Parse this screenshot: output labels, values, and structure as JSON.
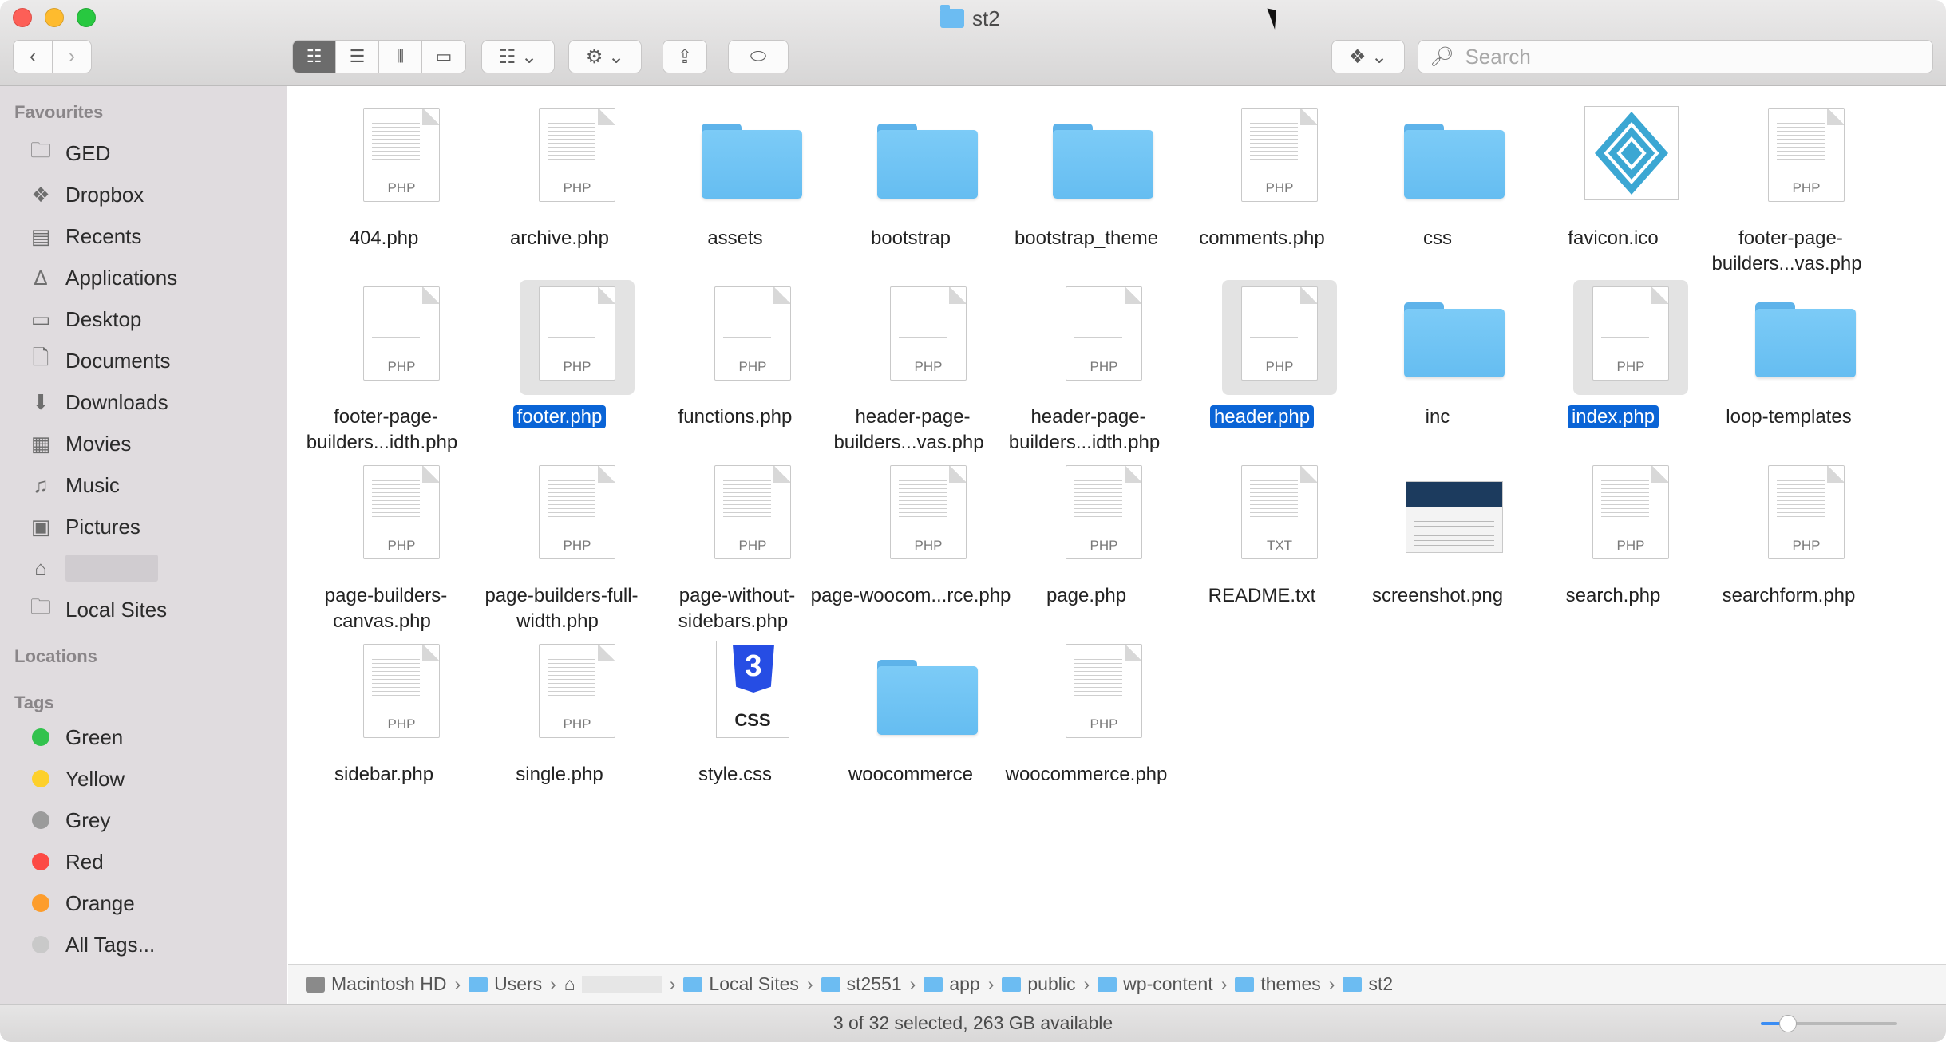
{
  "window": {
    "title": "st2"
  },
  "toolbar": {
    "back_icon": "chevron-left-icon",
    "forward_icon": "chevron-right-icon",
    "search_placeholder": "Search"
  },
  "sidebar": {
    "favourites_header": "Favourites",
    "favourites": [
      {
        "label": "GED",
        "icon": "folder-icon"
      },
      {
        "label": "Dropbox",
        "icon": "dropbox-icon"
      },
      {
        "label": "Recents",
        "icon": "clock-icon"
      },
      {
        "label": "Applications",
        "icon": "applications-icon"
      },
      {
        "label": "Desktop",
        "icon": "desktop-icon"
      },
      {
        "label": "Documents",
        "icon": "document-icon"
      },
      {
        "label": "Downloads",
        "icon": "download-icon"
      },
      {
        "label": "Movies",
        "icon": "film-icon"
      },
      {
        "label": "Music",
        "icon": "music-note-icon"
      },
      {
        "label": "Pictures",
        "icon": "camera-icon"
      },
      {
        "label": "",
        "icon": "home-icon"
      },
      {
        "label": "Local Sites",
        "icon": "folder-icon"
      }
    ],
    "locations_header": "Locations",
    "tags_header": "Tags",
    "tags": [
      {
        "label": "Green",
        "color": "#32c24d"
      },
      {
        "label": "Yellow",
        "color": "#fdd02b"
      },
      {
        "label": "Grey",
        "color": "#9b9b9b"
      },
      {
        "label": "Red",
        "color": "#fc4a44"
      },
      {
        "label": "Orange",
        "color": "#fd9d2c"
      },
      {
        "label": "All Tags...",
        "color": "#c9c9c9"
      }
    ]
  },
  "files": [
    {
      "name": "404.php",
      "type": "php",
      "selected": false
    },
    {
      "name": "archive.php",
      "type": "php",
      "selected": false
    },
    {
      "name": "assets",
      "type": "folder",
      "selected": false
    },
    {
      "name": "bootstrap",
      "type": "folder",
      "selected": false
    },
    {
      "name": "bootstrap_theme",
      "type": "folder",
      "selected": false
    },
    {
      "name": "comments.php",
      "type": "php",
      "selected": false
    },
    {
      "name": "css",
      "type": "folder",
      "selected": false
    },
    {
      "name": "favicon.ico",
      "type": "ico",
      "selected": false
    },
    {
      "name": "footer-page-builders...vas.php",
      "type": "php",
      "selected": false
    },
    {
      "name": "footer-page-builders...idth.php",
      "type": "php",
      "selected": false
    },
    {
      "name": "footer.php",
      "type": "php",
      "selected": true
    },
    {
      "name": "functions.php",
      "type": "php",
      "selected": false
    },
    {
      "name": "header-page-builders...vas.php",
      "type": "php",
      "selected": false
    },
    {
      "name": "header-page-builders...idth.php",
      "type": "php",
      "selected": false
    },
    {
      "name": "header.php",
      "type": "php",
      "selected": true
    },
    {
      "name": "inc",
      "type": "folder",
      "selected": false
    },
    {
      "name": "index.php",
      "type": "php",
      "selected": true
    },
    {
      "name": "loop-templates",
      "type": "folder",
      "selected": false
    },
    {
      "name": "page-builders-canvas.php",
      "type": "php",
      "selected": false
    },
    {
      "name": "page-builders-full-width.php",
      "type": "php",
      "selected": false
    },
    {
      "name": "page-without-sidebars.php",
      "type": "php",
      "selected": false
    },
    {
      "name": "page-woocom...rce.php",
      "type": "php",
      "selected": false
    },
    {
      "name": "page.php",
      "type": "php",
      "selected": false
    },
    {
      "name": "README.txt",
      "type": "txt",
      "selected": false
    },
    {
      "name": "screenshot.png",
      "type": "png",
      "selected": false
    },
    {
      "name": "search.php",
      "type": "php",
      "selected": false
    },
    {
      "name": "searchform.php",
      "type": "php",
      "selected": false
    },
    {
      "name": "sidebar.php",
      "type": "php",
      "selected": false
    },
    {
      "name": "single.php",
      "type": "php",
      "selected": false
    },
    {
      "name": "style.css",
      "type": "css",
      "selected": false
    },
    {
      "name": "woocommerce",
      "type": "folder",
      "selected": false
    },
    {
      "name": "woocommerce.php",
      "type": "php",
      "selected": false
    }
  ],
  "file_type_labels": {
    "php": "PHP",
    "txt": "TXT",
    "css": "CSS"
  },
  "pathbar": [
    {
      "label": "Macintosh HD",
      "icon": "disk-icon"
    },
    {
      "label": "Users",
      "icon": "folder-icon"
    },
    {
      "label": "",
      "icon": "home-icon"
    },
    {
      "label": "Local Sites",
      "icon": "folder-icon"
    },
    {
      "label": "st2551",
      "icon": "folder-icon"
    },
    {
      "label": "app",
      "icon": "folder-icon"
    },
    {
      "label": "public",
      "icon": "folder-icon"
    },
    {
      "label": "wp-content",
      "icon": "folder-icon"
    },
    {
      "label": "themes",
      "icon": "folder-icon"
    },
    {
      "label": "st2",
      "icon": "folder-icon"
    }
  ],
  "status": {
    "text": "3 of 32 selected, 263 GB available",
    "icon_size_level": 0.2
  }
}
